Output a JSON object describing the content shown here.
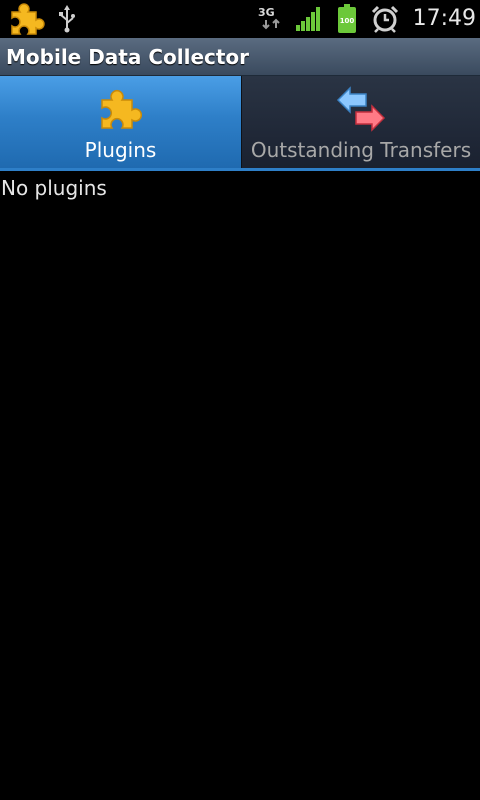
{
  "status_bar": {
    "time": "17:49",
    "network_label": "3G",
    "battery_level": "100",
    "icons": [
      "puzzle-icon",
      "usb-icon",
      "3g-data-icon",
      "signal-icon",
      "battery-icon",
      "alarm-icon"
    ]
  },
  "app": {
    "title": "Mobile Data Collector"
  },
  "tabs": [
    {
      "label": "Plugins",
      "icon": "puzzle-icon",
      "selected": true
    },
    {
      "label": "Outstanding Transfers",
      "icon": "transfer-arrows-icon",
      "selected": false
    }
  ],
  "content": {
    "empty_message": "No plugins"
  },
  "colors": {
    "accent": "#2e7fc8",
    "puzzle": "#f5b820",
    "background": "#000000"
  }
}
